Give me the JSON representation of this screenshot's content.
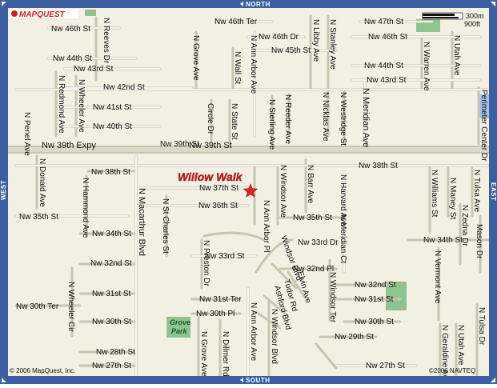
{
  "brand": {
    "logo_text": "MAPQUEST",
    "copyright_left": "© 2006 MapQuest, Inc.",
    "copyright_right": "©2006 NAVTEQ"
  },
  "navigation": {
    "north": "NORTH",
    "south": "SOUTH",
    "east": "EAST",
    "west": "WEST"
  },
  "scale": {
    "metric": "300m",
    "imperial": "900ft"
  },
  "location": {
    "name": "Willow Walk",
    "marker_icon": "star-icon",
    "marker_color": "#e8211c"
  },
  "parks": {
    "grove_park_line1": "Grove",
    "grove_park_line2": "Park"
  },
  "streets": {
    "nw_47th_st": "Nw 47th St",
    "nw_46th_ter": "Nw 46th Ter",
    "nw_46th_st_left": "Nw 46th St",
    "nw_46th_dr": "Nw 46th Dr",
    "nw_46th_st_right": "Nw 46th St",
    "nw_45th_st": "Nw 45th St",
    "nw_44th_st_left": "Nw 44th St",
    "nw_44th_st_right": "Nw 44th St",
    "nw_43rd_st_left": "Nw 43rd St",
    "nw_43rd_st_right": "Nw 43rd St",
    "nw_42nd_st": "Nw 42nd St",
    "nw_41st_st": "Nw 41st St",
    "nw_40th_st": "Nw 40th St",
    "nw_39th_expy": "Nw 39th Expy",
    "nw_39th_st_a": "Nw 39th St",
    "nw_39th_st_b": "Nw 39th St",
    "nw_38th_st_left": "Nw 38th St",
    "nw_38th_st_right": "Nw 38th St",
    "nw_37th_st": "Nw 37th St",
    "nw_36th_st": "Nw 36th St",
    "nw_35th_st_left": "Nw 35th St",
    "nw_35th_st_right": "Nw 35th St",
    "nw_34th_st_left": "Nw 34th St",
    "nw_34th_st_right": "Nw 34th St",
    "nw_33rd_st": "Nw 33rd St",
    "nw_33rd_dr": "Nw 33rd Dr",
    "nw_32nd_st_left": "Nw 32nd St",
    "nw_32nd_pl": "Nw 32nd Pl",
    "nw_32nd_st_right": "Nw 32nd St",
    "nw_31st_st_left": "Nw 31st St",
    "nw_31st_ter": "Nw 31st Ter",
    "nw_31st_st_right": "Nw 31st St",
    "nw_30th_ter": "Nw 30th Ter",
    "nw_30th_pl": "Nw 30th Pl",
    "nw_30th_st_left": "Nw 30th St",
    "nw_30th_st_right": "Nw 30th St",
    "nw_29th_st": "Nw 29th St",
    "nw_28th_st": "Nw 28th St",
    "nw_27th_st_left": "Nw 27th St",
    "nw_27th_st_right": "Nw 27th St",
    "n_reeves_dr": "N Reeves Dr",
    "n_grove_ave_top": "N Grove Ave",
    "n_wall_st": "N Wall St",
    "n_ann_arbor_ave_top": "N Ann Arbor Ave",
    "n_libby_ave": "N Libby Ave",
    "n_stanley_ave": "N Stanley Ave",
    "n_warren_ave": "N Warren Ave",
    "n_utah_ave_top": "N Utah Ave",
    "n_redmond_ave": "N Redmond Ave",
    "n_wheeler_ave": "N Wheeler Ave",
    "circle_dr": "Circle Dr",
    "n_state_st": "N State St",
    "n_sterling_ave": "N Sterling Ave",
    "n_reeder_ave": "N Reeder Ave",
    "n_nicklas_ave": "N Nicklas Ave",
    "n_westridge_st": "N Westridge St",
    "n_meridian_ave": "N Meridian Ave",
    "perimeter_center_dr": "Perimeter Center Dr",
    "n_penel_ave": "N Penel Ave",
    "n_donald_ave": "N Donald Ave",
    "n_hammond_ave": "N Hammond Ave",
    "n_macarthur_blvd": "N Macarthur Blvd",
    "n_st_charles_st": "N St Charles St",
    "n_windsor_ave": "N Windsor Ave",
    "n_barr_ave": "N Barr Ave",
    "n_harvard_ave": "N Harvard Ave",
    "n_williams_st": "N Williams St",
    "n_maney_st": "N Maney St",
    "n_tulsa_ave_top": "N Tulsa Ave",
    "n_ann_arbor_pl": "N Ann Arbor Pl",
    "n_meridian_ct": "N Meridian Ct",
    "n_zedna_dr": "N Zedna Dr",
    "mason_dr": "Mason Dr",
    "n_preston_dr": "N Preston Dr",
    "windsor_blvd": "Windsor Blvd",
    "elvin_ave": "Elvin Ave",
    "n_windsor_ter": "N Windsor Ter",
    "n_vermont_ave": "N Vermont Ave",
    "n_wheeler_cir": "N Wheeler Cir",
    "tudor_rd": "Tudor Rd",
    "ashford_blvd": "Ashford Blvd",
    "n_ann_arbor_ave_bottom": "N Ann Arbor Ave",
    "n_windsor_blvd": "N Windsor Blvd",
    "n_grove_ave_bottom": "N Grove Ave",
    "n_dillmer_rd": "N Dillmer Rd",
    "n_geraldine_ave": "N Geraldine Ave",
    "n_utah_ave_bottom": "N Utah Ave",
    "n_tulsa_dr": "N Tulsa Dr"
  },
  "colors": {
    "land": "#f2f0e2",
    "street": "#ffffff",
    "street_edge": "#c8c5b0",
    "highway": "#d8d6c8",
    "water": "#a4c0e4",
    "park": "#8fc490",
    "frame": "#3b5fa0"
  }
}
